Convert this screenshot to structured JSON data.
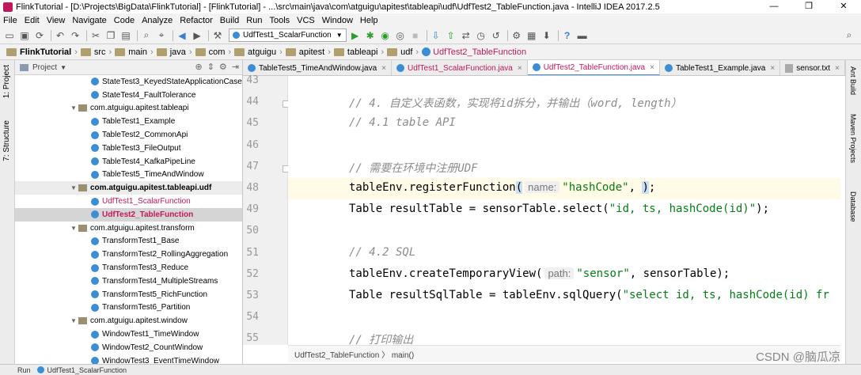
{
  "window": {
    "title": "FlinkTutorial - [D:\\Projects\\BigData\\FlinkTutorial] - [FlinkTutorial] - ...\\src\\main\\java\\com\\atguigu\\apitest\\tableapi\\udf\\UdfTest2_TableFunction.java - IntelliJ IDEA 2017.2.5",
    "controls": {
      "minimize": "—",
      "maximize": "❐",
      "close": "✕"
    }
  },
  "menu": [
    "File",
    "Edit",
    "View",
    "Navigate",
    "Code",
    "Analyze",
    "Refactor",
    "Build",
    "Run",
    "Tools",
    "VCS",
    "Window",
    "Help"
  ],
  "toolbar": {
    "run_config": "UdfTest1_ScalarFunction"
  },
  "breadcrumbs": [
    "FlinkTutorial",
    "src",
    "main",
    "java",
    "com",
    "atguigu",
    "apitest",
    "tableapi",
    "udf",
    "UdfTest2_TableFunction"
  ],
  "left_strip": {
    "project": "1: Project",
    "structure": "7: Structure"
  },
  "project_panel": {
    "header": "Project",
    "tree": [
      {
        "label": "StateTest3_KeyedStateApplicationCase",
        "kind": "class",
        "indent": 2
      },
      {
        "label": "StateTest4_FaultTolerance",
        "kind": "class",
        "indent": 2
      },
      {
        "label": "com.atguigu.apitest.tableapi",
        "kind": "package",
        "indent": 1
      },
      {
        "label": "TableTest1_Example",
        "kind": "class",
        "indent": 2
      },
      {
        "label": "TableTest2_CommonApi",
        "kind": "class",
        "indent": 2
      },
      {
        "label": "TableTest3_FileOutput",
        "kind": "class",
        "indent": 2
      },
      {
        "label": "TableTest4_KafkaPipeLine",
        "kind": "class",
        "indent": 2
      },
      {
        "label": "TableTest5_TimeAndWindow",
        "kind": "class",
        "indent": 2
      },
      {
        "label": "com.atguigu.apitest.tableapi.udf",
        "kind": "package",
        "indent": 1,
        "state": "highlight"
      },
      {
        "label": "UdfTest1_ScalarFunction",
        "kind": "class",
        "indent": 2,
        "red": true
      },
      {
        "label": "UdfTest2_TableFunction",
        "kind": "class",
        "indent": 2,
        "red": true,
        "state": "selected"
      },
      {
        "label": "com.atguigu.apitest.transform",
        "kind": "package",
        "indent": 1
      },
      {
        "label": "TransformTest1_Base",
        "kind": "class",
        "indent": 2
      },
      {
        "label": "TransformTest2_RollingAggregation",
        "kind": "class",
        "indent": 2
      },
      {
        "label": "TransformTest3_Reduce",
        "kind": "class",
        "indent": 2
      },
      {
        "label": "TransformTest4_MultipleStreams",
        "kind": "class",
        "indent": 2
      },
      {
        "label": "TransformTest5_RichFunction",
        "kind": "class",
        "indent": 2
      },
      {
        "label": "TransformTest6_Partition",
        "kind": "class",
        "indent": 2
      },
      {
        "label": "com.atguigu.apitest.window",
        "kind": "package",
        "indent": 1
      },
      {
        "label": "WindowTest1_TimeWindow",
        "kind": "class",
        "indent": 2
      },
      {
        "label": "WindowTest2_CountWindow",
        "kind": "class",
        "indent": 2
      },
      {
        "label": "WindowTest3_EventTimeWindow",
        "kind": "class",
        "indent": 2
      }
    ]
  },
  "tabs": [
    {
      "label": "TableTest5_TimeAndWindow.java",
      "red": false,
      "active": false
    },
    {
      "label": "UdfTest1_ScalarFunction.java",
      "red": true,
      "active": false
    },
    {
      "label": "UdfTest2_TableFunction.java",
      "red": true,
      "active": true
    },
    {
      "label": "TableTest1_Example.java",
      "red": false,
      "active": false
    },
    {
      "label": "sensor.txt",
      "red": false,
      "active": false
    }
  ],
  "editor": {
    "lines": [
      {
        "num": "43",
        "parts": []
      },
      {
        "num": "44",
        "parts": [
          {
            "t": "// 4. 自定义表函数，实现将id拆分，并输出（word, length）",
            "c": "cmt"
          }
        ]
      },
      {
        "num": "45",
        "parts": [
          {
            "t": "// 4.1 table API",
            "c": "cmt"
          }
        ]
      },
      {
        "num": "46",
        "parts": []
      },
      {
        "num": "47",
        "parts": [
          {
            "t": "// 需要在环境中注册UDF",
            "c": "cmt"
          }
        ]
      },
      {
        "num": "48",
        "current": true,
        "parts": [
          {
            "t": "tableEnv.registerFunction"
          },
          {
            "t": "(",
            "c": "brk"
          },
          {
            "t": "name:",
            "c": "hint"
          },
          {
            "t": "\"hashCode\"",
            "c": "str"
          },
          {
            "t": ", "
          },
          {
            "t": ")",
            "c": "brk"
          },
          {
            "t": ";"
          }
        ]
      },
      {
        "num": "49",
        "parts": [
          {
            "t": "Table resultTable = sensorTable.select("
          },
          {
            "t": "\"id, ts, hashCode(id)\"",
            "c": "str"
          },
          {
            "t": ");"
          }
        ]
      },
      {
        "num": "50",
        "parts": []
      },
      {
        "num": "51",
        "parts": [
          {
            "t": "// 4.2 SQL",
            "c": "cmt"
          }
        ]
      },
      {
        "num": "52",
        "parts": [
          {
            "t": "tableEnv.createTemporaryView("
          },
          {
            "t": "path:",
            "c": "hint"
          },
          {
            "t": "\"sensor\"",
            "c": "str"
          },
          {
            "t": ", sensorTable);"
          }
        ]
      },
      {
        "num": "53",
        "parts": [
          {
            "t": "Table resultSqlTable = tableEnv.sqlQuery("
          },
          {
            "t": "\"select id, ts, hashCode(id) fr",
            "c": "str"
          }
        ]
      },
      {
        "num": "54",
        "parts": []
      },
      {
        "num": "55",
        "parts": [
          {
            "t": "// 打印输出",
            "c": "cmt"
          }
        ]
      }
    ],
    "breadcrumb": "UdfTest2_TableFunction  〉  main()"
  },
  "right_strip": [
    "Ant Build",
    "Maven Projects",
    "Database"
  ],
  "run_bar": {
    "label": "Run",
    "config": "UdfTest1_ScalarFunction"
  },
  "watermark": "CSDN @脑瓜凉"
}
